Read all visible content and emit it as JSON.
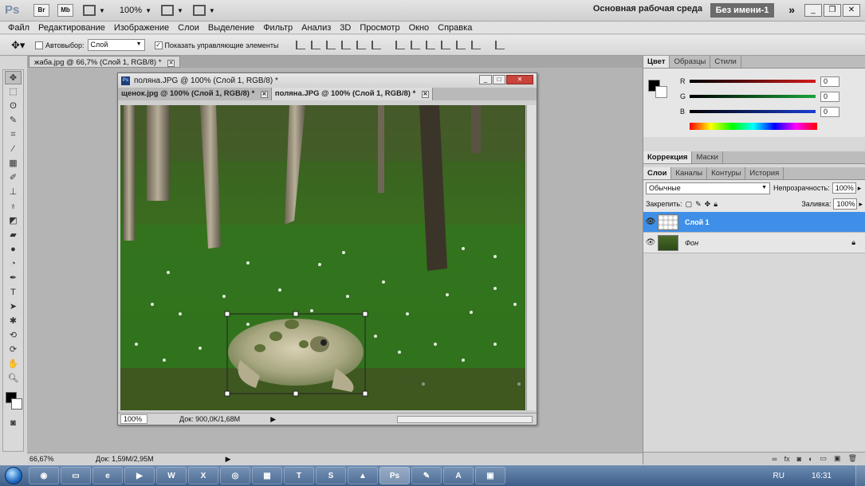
{
  "app": {
    "logo": "Ps",
    "bridge_btn": "Br",
    "minibridge_btn": "Mb",
    "zoom": "100%",
    "workspace": "Основная рабочая среда",
    "workspace_name": "Без имени-1"
  },
  "menu": [
    "Файл",
    "Редактирование",
    "Изображение",
    "Слои",
    "Выделение",
    "Фильтр",
    "Анализ",
    "3D",
    "Просмотр",
    "Окно",
    "Справка"
  ],
  "options": {
    "autoselect_label": "Автовыбор:",
    "autoselect_value": "Слой",
    "show_controls_label": "Показать управляющие элементы"
  },
  "doc": {
    "tab_label": "жаба.jpg @ 66,7% (Слой 1, RGB/8) *",
    "zoom": "66,67%",
    "doc_info": "Док: 1,59M/2,95M"
  },
  "float_window": {
    "title": "поляна.JPG @ 100% (Слой 1, RGB/8) *",
    "tabs": [
      {
        "label": "щенок.jpg @ 100% (Слой 1, RGB/8) *"
      },
      {
        "label": "поляна.JPG @ 100% (Слой 1, RGB/8) *"
      }
    ],
    "zoom": "100%",
    "doc_info": "Док: 900,0K/1,68M"
  },
  "color_panel": {
    "tabs": [
      "Цвет",
      "Образцы",
      "Стили"
    ],
    "channels": [
      {
        "name": "R",
        "value": "0",
        "color": "#d21b1b"
      },
      {
        "name": "G",
        "value": "0",
        "color": "#1aa33a"
      },
      {
        "name": "B",
        "value": "0",
        "color": "#1b3fd2"
      }
    ]
  },
  "adjust_tabs": [
    "Коррекция",
    "Маски"
  ],
  "layers_panel": {
    "tabs": [
      "Слои",
      "Каналы",
      "Контуры",
      "История"
    ],
    "blend_mode": "Обычные",
    "opacity_label": "Непрозрачность:",
    "opacity": "100%",
    "lock_label": "Закрепить:",
    "fill_label": "Заливка:",
    "fill": "100%",
    "layers": [
      {
        "name": "Слой 1",
        "selected": true
      },
      {
        "name": "Фон",
        "selected": false
      }
    ]
  },
  "taskbar": {
    "ps_label": "Ps",
    "lang": "RU",
    "clock": "16:31"
  }
}
